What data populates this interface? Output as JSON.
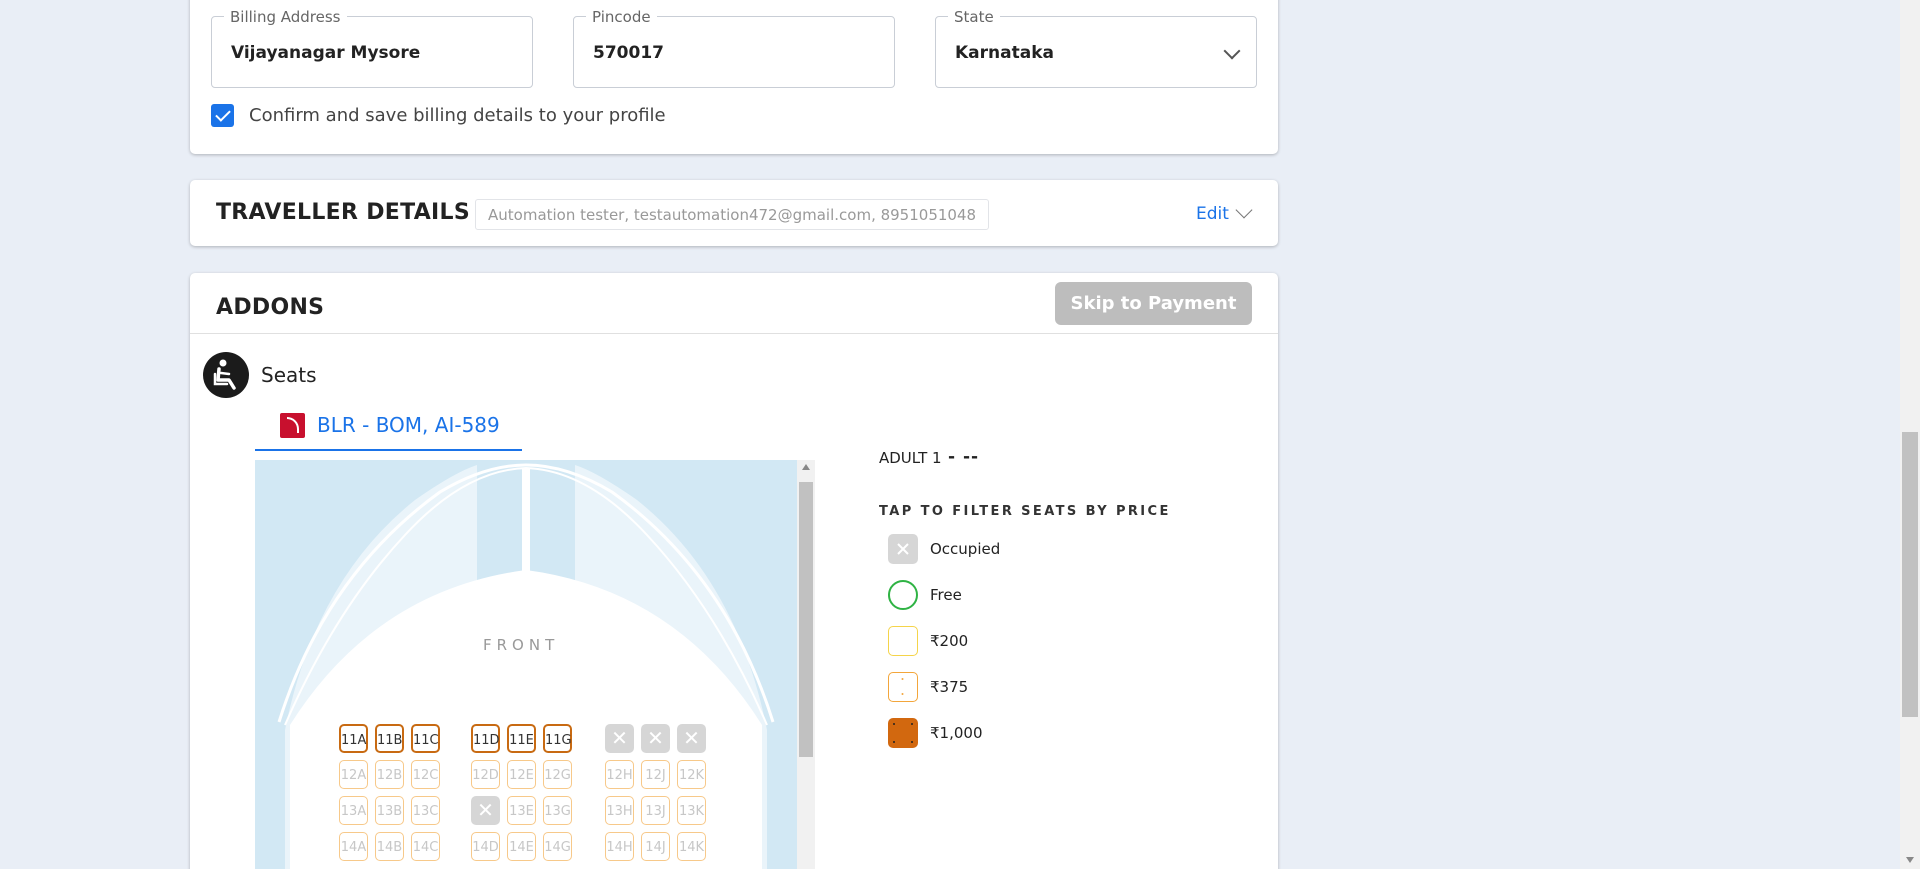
{
  "billing": {
    "address_label": "Billing Address",
    "address_value": "Vijayanagar Mysore",
    "pincode_label": "Pincode",
    "pincode_value": "570017",
    "state_label": "State",
    "state_value": "Karnataka",
    "confirm_label": "Confirm and save billing details to your profile"
  },
  "traveller": {
    "title": "TRAVELLER DETAILS",
    "summary": "Automation tester, testautomation472@gmail.com, 8951051048",
    "edit_label": "Edit"
  },
  "addons": {
    "title": "ADDONS",
    "skip_label": "Skip to Payment",
    "seats_label": "Seats",
    "flight_tab": "BLR - BOM, AI-589",
    "front_label": "FRONT",
    "adult_label": "ADULT 1",
    "adult_seat": "- --",
    "filter_heading": "TAP TO FILTER SEATS BY PRICE",
    "legend": [
      {
        "label": "Occupied",
        "color": "#d6d6d6"
      },
      {
        "label": "Free",
        "color": "#2fb344"
      },
      {
        "label": "₹200",
        "color": "#f5d44a"
      },
      {
        "label": "₹375",
        "color": "#f3a63b"
      },
      {
        "label": "₹1,000",
        "color": "#d2680f"
      }
    ],
    "seat_rows": [
      [
        "11A",
        "11B",
        "11C",
        "11D",
        "11E",
        "11G",
        "X",
        "X",
        "X"
      ],
      [
        "12A",
        "12B",
        "12C",
        "12D",
        "12E",
        "12G",
        "12H",
        "12J",
        "12K"
      ],
      [
        "13A",
        "13B",
        "13C",
        "X",
        "13E",
        "13G",
        "13H",
        "13J",
        "13K"
      ],
      [
        "14A",
        "14B",
        "14C",
        "14D",
        "14E",
        "14G",
        "14H",
        "14J",
        "14K"
      ]
    ]
  }
}
